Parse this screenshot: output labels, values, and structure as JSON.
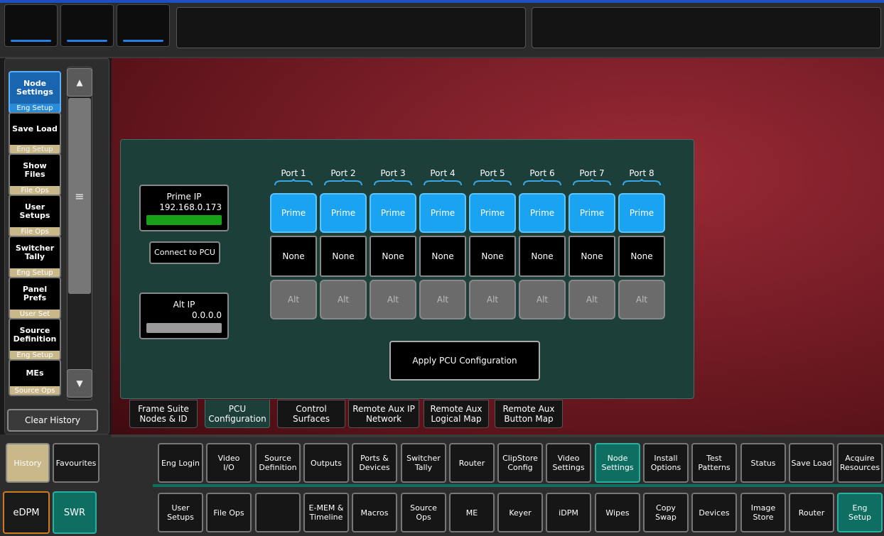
{
  "sidebar": {
    "items": [
      {
        "label": "Node Settings",
        "sub": "Eng  Setup"
      },
      {
        "label": "Save Load",
        "sub": "Eng  Setup"
      },
      {
        "label": "Show Files",
        "sub": "File Ops"
      },
      {
        "label": "User Setups",
        "sub": "File Ops"
      },
      {
        "label": "Switcher Tally",
        "sub": "Eng  Setup"
      },
      {
        "label": "Panel Prefs",
        "sub": "User Set"
      },
      {
        "label": "Source Definition",
        "sub": "Eng  Setup"
      },
      {
        "label": "MEs",
        "sub": "Source Ops"
      }
    ],
    "clear_history": "Clear History",
    "history": "History",
    "favourites": "Favourites",
    "edpm": "eDPM",
    "swr": "SWR"
  },
  "pcu": {
    "prime_ip_label": "Prime IP",
    "prime_ip_value": "192.168.0.173",
    "connect_label": "Connect to PCU",
    "alt_ip_label": "Alt IP",
    "alt_ip_value": "0.0.0.0",
    "apply_label": "Apply PCU Configuration",
    "ports": [
      {
        "label": "Port 1",
        "prime": "Prime",
        "value": "None",
        "alt": "Alt"
      },
      {
        "label": "Port 2",
        "prime": "Prime",
        "value": "None",
        "alt": "Alt"
      },
      {
        "label": "Port 3",
        "prime": "Prime",
        "value": "None",
        "alt": "Alt"
      },
      {
        "label": "Port 4",
        "prime": "Prime",
        "value": "None",
        "alt": "Alt"
      },
      {
        "label": "Port 5",
        "prime": "Prime",
        "value": "None",
        "alt": "Alt"
      },
      {
        "label": "Port 6",
        "prime": "Prime",
        "value": "None",
        "alt": "Alt"
      },
      {
        "label": "Port 7",
        "prime": "Prime",
        "value": "None",
        "alt": "Alt"
      },
      {
        "label": "Port 8",
        "prime": "Prime",
        "value": "None",
        "alt": "Alt"
      }
    ]
  },
  "tabs": [
    "Frame Suite\nNodes & ID",
    "PCU\nConfiguration",
    "Control\nSurfaces",
    "Remote Aux IP\nNetwork",
    "Remote Aux\nLogical Map",
    "Remote Aux\nButton Map"
  ],
  "nav_top": [
    "Eng Login",
    "Video\nI/O",
    "Source\nDefinition",
    "Outputs",
    "Ports &\nDevices",
    "Switcher\nTally",
    "Router",
    "ClipStore\nConfig",
    "Video\nSettings",
    "Node\nSettings",
    "Install\nOptions",
    "Test\nPatterns",
    "Status",
    "Save Load",
    "Acquire\nResources"
  ],
  "nav_bottom": [
    "User\nSetups",
    "File Ops",
    "",
    "E-MEM &\nTimeline",
    "Macros",
    "Source\nOps",
    "ME",
    "Keyer",
    "iDPM",
    "Wipes",
    "Copy\nSwap",
    "Devices",
    "Image\nStore",
    "Router",
    "Eng\nSetup"
  ],
  "colors": {
    "selected_teal": "#0e6e62",
    "prime_blue": "#1aa3f0",
    "panel_green": "#1c3f3a"
  }
}
